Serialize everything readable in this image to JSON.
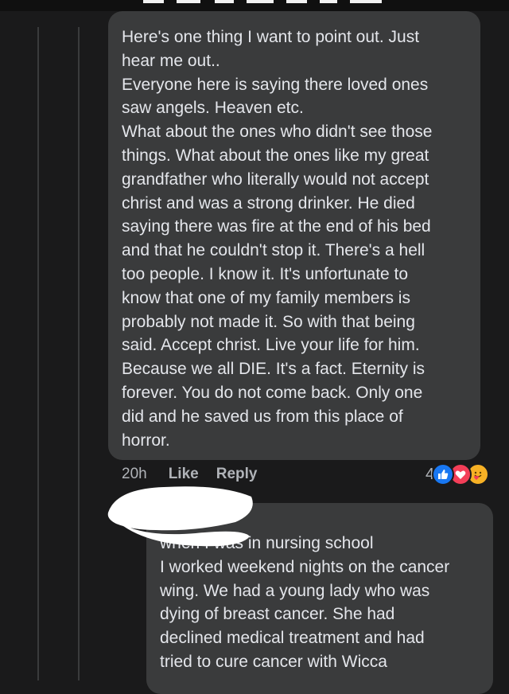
{
  "comment": {
    "text": "Here's one thing I want to point out. Just\nhear me out..\nEveryone here is saying there loved ones\nsaw angels. Heaven etc.\nWhat about the ones who didn't see those\nthings. What about the ones like my great\ngrandfather who literally would not accept\nchrist and was a strong drinker. He died\nsaying there was fire at the end of his bed\nand that he couldn't stop it. There's a hell\ntoo people. I know it. It's unfortunate to\nknow that one of my family members is\nprobably not made it. So with that being\nsaid. Accept christ. Live your life for him.\nBecause we all DIE. It's a fact. Eternity is\nforever. You do not come back. Only one\ndid and he saved us from this place of\nhorror.",
    "time": "20h",
    "like_label": "Like",
    "reply_label": "Reply",
    "reaction_count": "4",
    "reactions": [
      "like-icon",
      "love-icon",
      "care-icon"
    ]
  },
  "reply": {
    "text": "when I was in nursing school\nI worked weekend nights on the cancer\nwing. We had a young lady who was\ndying of breast cancer. She had\ndeclined medical treatment and had\ntried to cure cancer with Wicca"
  },
  "colors": {
    "background": "#1a1a1b",
    "bubble": "#3a3b3c",
    "text": "#e4e6eb",
    "secondary_text": "#b0b3b8",
    "like_blue": "#1877f2",
    "love_red": "#f33e58",
    "care_yellow": "#f7b125"
  }
}
